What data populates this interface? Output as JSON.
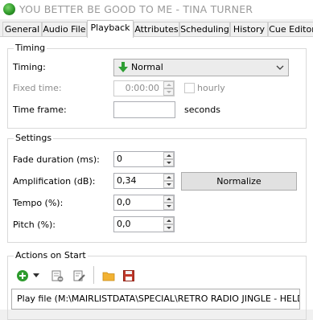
{
  "window": {
    "title": "YOU BETTER BE GOOD TO ME - TINA TURNER"
  },
  "tabs": [
    "General",
    "Audio File",
    "Playback",
    "Attributes",
    "Scheduling",
    "History",
    "Cue Editor"
  ],
  "active_tab": "Playback",
  "timing_group": {
    "legend": "Timing",
    "timing_label": "Timing:",
    "timing_value": "Normal",
    "fixed_time_label": "Fixed time:",
    "fixed_time_value": "0:00:00",
    "hourly_label": "hourly",
    "time_frame_label": "Time frame:",
    "time_frame_value": "",
    "seconds_label": "seconds"
  },
  "settings_group": {
    "legend": "Settings",
    "fade_label": "Fade duration (ms):",
    "fade_value": "0",
    "amp_label": "Amplification (dB):",
    "amp_value": "0,34",
    "normalize_label": "Normalize",
    "tempo_label": "Tempo (%):",
    "tempo_value": "0,0",
    "pitch_label": "Pitch (%):",
    "pitch_value": "0,0"
  },
  "actions_group": {
    "legend": "Actions on Start",
    "items": [
      "Play file (M:\\MAIRLISTDATA\\SPECIAL\\RETRO RADIO JINGLE - HELD ..."
    ]
  },
  "colors": {
    "arrow_green": "#2e9e34",
    "add_green": "#2d9b2d",
    "folder": "#f2b233",
    "save_red": "#c0392b"
  }
}
